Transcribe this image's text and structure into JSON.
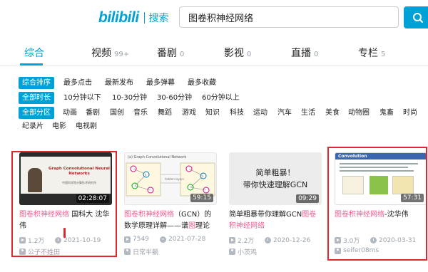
{
  "header": {
    "logo_mark": "bilibili",
    "logo_text": "搜索",
    "search_value": "图卷积神经网络",
    "brand_color": "#00a1d6"
  },
  "tabs": [
    {
      "label": "综合",
      "count": "",
      "active": true
    },
    {
      "label": "视频",
      "count": "99+"
    },
    {
      "label": "番剧",
      "count": "0"
    },
    {
      "label": "影视",
      "count": "0"
    },
    {
      "label": "直播",
      "count": "0"
    },
    {
      "label": "专栏",
      "count": "5"
    }
  ],
  "filters": {
    "order": [
      "综合排序",
      "最多点击",
      "最新发布",
      "最多弹幕",
      "最多收藏"
    ],
    "duration": [
      "全部时长",
      "10分钟以下",
      "10-30分钟",
      "30-60分钟",
      "60分钟以上"
    ],
    "zones_row1": [
      "全部分区",
      "动画",
      "番剧",
      "国创",
      "音乐",
      "舞蹈",
      "游戏",
      "知识",
      "科技",
      "运动",
      "汽车",
      "生活",
      "美食",
      "动物圈",
      "鬼畜",
      "时尚"
    ],
    "zones_row2": [
      "纪录片",
      "电影",
      "电视剧"
    ]
  },
  "cards": [
    {
      "duration": "02:28:07",
      "title_hl": "图卷积神经网络",
      "title_rest": " 国科大 沈华伟",
      "title_hl2": "",
      "title_rest2": "",
      "views": "1.2万",
      "date": "2021-10-19",
      "uploader": "公子不姓田",
      "thumb_title": "Graph Convolutional Neural Networks",
      "thumb_sub": "中国科学院计算技术研究所"
    },
    {
      "duration": "59:15",
      "title_hl": "图卷积神经网络",
      "title_rest": "（GCN）的数学原理详解——谱",
      "title_hl2": "图",
      "title_rest2": "理论",
      "views": "7549",
      "date": "2021-07-28",
      "uploader": "日常半躺",
      "thumb_title": "(a) Graph Convolutional Network",
      "thumb_sub": "hidden layers"
    },
    {
      "duration": "09:29",
      "title_hl": "",
      "title_rest": "简单粗暴带你理解GCN",
      "title_hl2": "图卷积神经网络",
      "title_rest2": "",
      "views": "2.2万",
      "date": "2020-12-26",
      "uploader": "小茨鸡",
      "thumb_line1": "简单粗暴！",
      "thumb_line2": "带你快速理解GCN"
    },
    {
      "duration": "57:31",
      "title_hl": "图卷积神经网络",
      "title_rest": "-沈华伟",
      "title_hl2": "",
      "title_rest2": "",
      "views": "3.0万",
      "date": "2020-03-31",
      "uploader": "seifer08ms",
      "thumb_title": "Convolution"
    }
  ],
  "colors": {
    "highlight": "#f25d8e",
    "annotation_box": "#e3262b"
  }
}
